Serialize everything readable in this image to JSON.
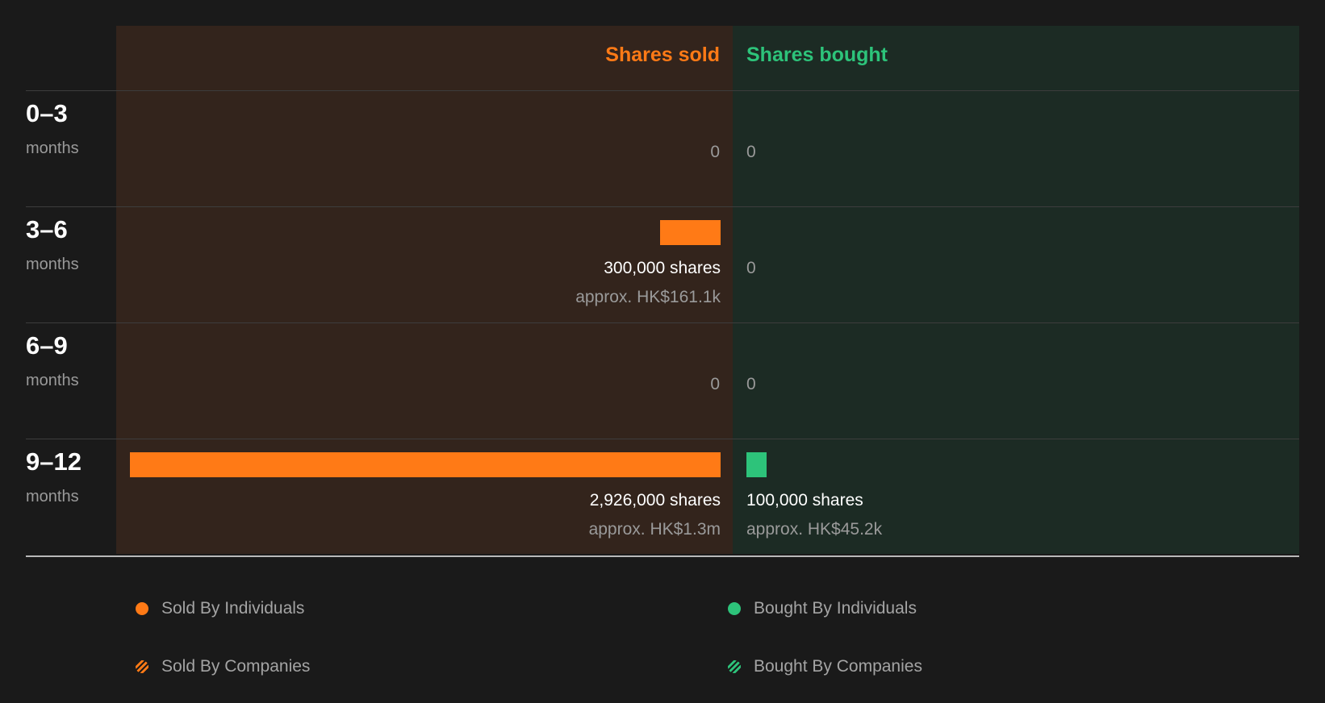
{
  "chart_data": {
    "type": "bar",
    "columns": {
      "sold": "Shares sold",
      "bought": "Shares bought"
    },
    "categories": [
      {
        "period": "0–3",
        "unit": "months"
      },
      {
        "period": "3–6",
        "unit": "months"
      },
      {
        "period": "6–9",
        "unit": "months"
      },
      {
        "period": "9–12",
        "unit": "months"
      }
    ],
    "series": [
      {
        "name": "Shares sold",
        "values": [
          0,
          300000,
          0,
          2926000
        ],
        "labels": [
          "0",
          "300,000 shares",
          "0",
          "2,926,000 shares"
        ],
        "approx": [
          "",
          "approx. HK$161.1k",
          "",
          "approx. HK$1.3m"
        ]
      },
      {
        "name": "Shares bought",
        "values": [
          0,
          0,
          0,
          100000
        ],
        "labels": [
          "0",
          "0",
          "0",
          "100,000 shares"
        ],
        "approx": [
          "",
          "",
          "",
          "approx. HK$45.2k"
        ]
      }
    ],
    "legend": [
      {
        "label": "Sold By Individuals",
        "color": "#ff7a16",
        "pattern": "solid"
      },
      {
        "label": "Bought By Individuals",
        "color": "#2dc37a",
        "pattern": "solid"
      },
      {
        "label": "Sold By Companies",
        "color": "#ff7a16",
        "pattern": "striped"
      },
      {
        "label": "Bought By Companies",
        "color": "#2dc37a",
        "pattern": "striped"
      }
    ]
  },
  "colors": {
    "sold": "#ff7a16",
    "bought": "#2dc37a"
  }
}
